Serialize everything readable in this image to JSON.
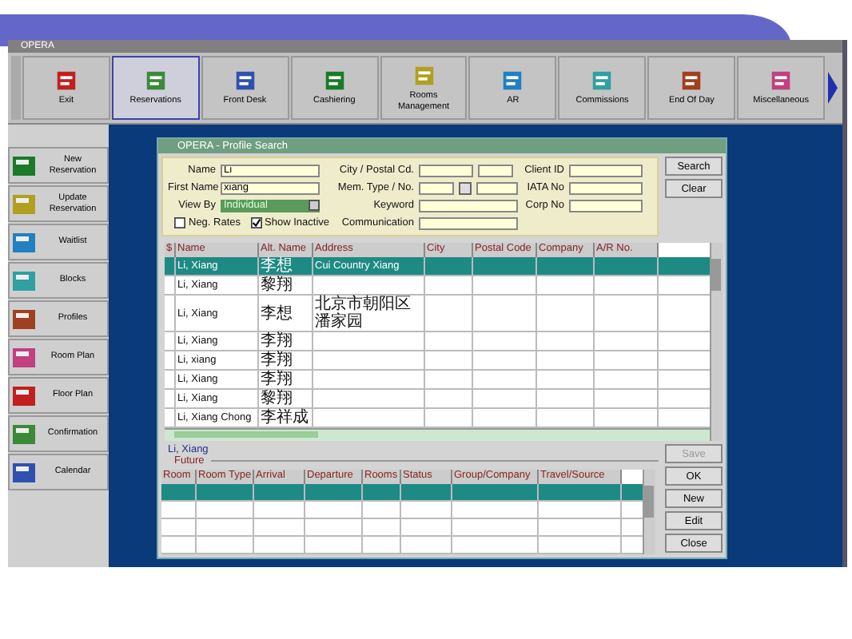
{
  "app": {
    "title": "OPERA"
  },
  "toolbar": [
    {
      "label": "Exit",
      "selected": false
    },
    {
      "label": "Reservations",
      "selected": true
    },
    {
      "label": "Front Desk",
      "selected": false
    },
    {
      "label": "Cashiering",
      "selected": false
    },
    {
      "label": "Rooms Management",
      "selected": false
    },
    {
      "label": "AR",
      "selected": false
    },
    {
      "label": "Commissions",
      "selected": false
    },
    {
      "label": "End Of Day",
      "selected": false
    },
    {
      "label": "Miscellaneous",
      "selected": false
    }
  ],
  "sidebar": [
    {
      "label": "New Reservation"
    },
    {
      "label": "Update Reservation"
    },
    {
      "label": "Waitlist"
    },
    {
      "label": "Blocks"
    },
    {
      "label": "Profiles"
    },
    {
      "label": "Room Plan"
    },
    {
      "label": "Floor Plan"
    },
    {
      "label": "Confirmation"
    },
    {
      "label": "Calendar"
    }
  ],
  "dialog": {
    "title": "OPERA - Profile Search",
    "left_fields": [
      {
        "label": "Name",
        "value": "Li"
      },
      {
        "label": "First Name",
        "value": "xiang"
      }
    ],
    "view_by": {
      "label": "View By",
      "value": "Individual"
    },
    "options": [
      {
        "label": "Neg. Rates",
        "checked": false
      },
      {
        "label": "Show Inactive",
        "checked": true
      }
    ],
    "mid_fields": [
      {
        "label": "City / Postal Cd.",
        "kind": "double"
      },
      {
        "label": "Mem. Type / No.",
        "kind": "lookup"
      },
      {
        "label": "Keyword",
        "kind": "single"
      },
      {
        "label": "Communication",
        "kind": "single"
      }
    ],
    "right_fields": [
      {
        "label": "Client ID"
      },
      {
        "label": "IATA No"
      },
      {
        "label": "Corp No"
      }
    ],
    "buttons": [
      "Search",
      "Clear"
    ]
  },
  "results": {
    "columns": [
      "$",
      "Name",
      "Alt. Name",
      "Address",
      "City",
      "Postal Code",
      "Company",
      "A/R No."
    ],
    "rows": [
      {
        "name": "Li, Xiang",
        "alt_name": "李想",
        "address": "Cui Country Xiang",
        "selected": true
      },
      {
        "name": "Li, Xiang",
        "alt_name": "黎翔",
        "selected": false
      },
      {
        "name": "Li, Xiang",
        "alt_name": "李想",
        "address": "北京市朝阳区潘家园",
        "selected": false
      },
      {
        "name": "Li, Xiang",
        "alt_name": "李翔",
        "selected": false
      },
      {
        "name": "Li, xiang",
        "alt_name": "李翔",
        "selected": false
      },
      {
        "name": "Li, Xiang",
        "alt_name": "李翔",
        "selected": false
      },
      {
        "name": "Li, Xiang",
        "alt_name": "黎翔",
        "selected": false
      },
      {
        "name": "Li, Xiang Chong",
        "alt_name": "李祥成",
        "selected": false
      }
    ]
  },
  "detail": {
    "name": "Li, Xiang",
    "group": "Future",
    "columns": [
      "Room",
      "Room Type",
      "Arrival",
      "Departure",
      "Rooms",
      "Status",
      "Group/Company",
      "Travel/Source"
    ],
    "rows": [
      {
        "selected": true
      },
      {
        "selected": false
      },
      {
        "selected": false
      },
      {
        "selected": false
      }
    ],
    "buttons": [
      {
        "label": "Save",
        "disabled": true
      },
      {
        "label": "OK",
        "disabled": false
      },
      {
        "label": "New",
        "disabled": false
      },
      {
        "label": "Edit",
        "disabled": false
      },
      {
        "label": "Close",
        "disabled": false
      }
    ]
  }
}
